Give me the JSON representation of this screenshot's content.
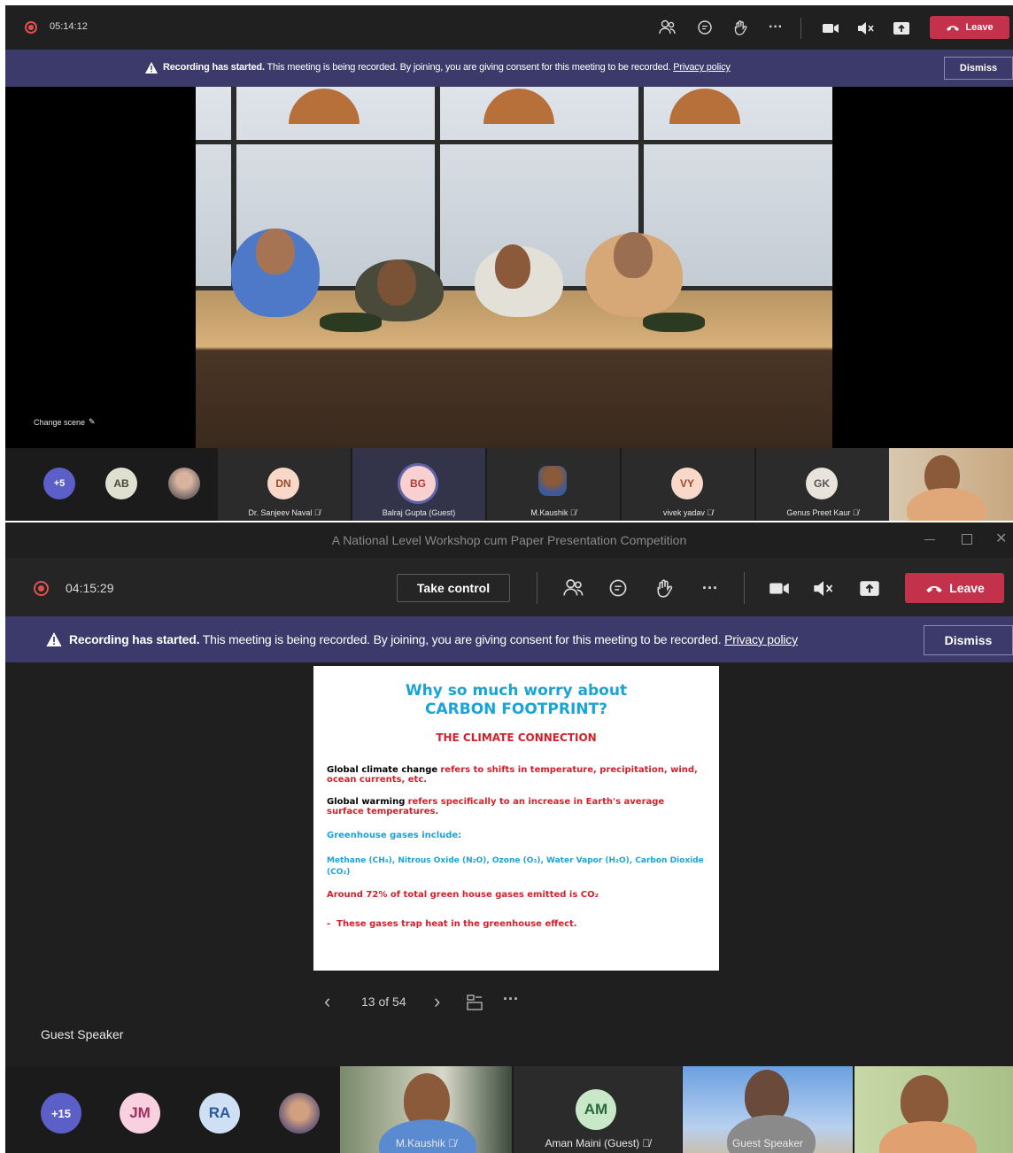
{
  "window1": {
    "timer": "05:14:12",
    "leave_label": "Leave",
    "banner": {
      "title": "Recording has started.",
      "text": "This meeting is being recorded. By joining, you are giving consent for this meeting to be recorded.",
      "link": "Privacy policy",
      "dismiss": "Dismiss"
    },
    "change_scene": "Change scene",
    "participants": [
      {
        "initials": "+5"
      },
      {
        "initials": "AB"
      },
      {
        "initials": ""
      },
      {
        "initials": "DN",
        "name": "Dr. Sanjeev Naval"
      },
      {
        "initials": "BG",
        "name": "Balraj Gupta (Guest)"
      },
      {
        "initials": "",
        "name": "M.Kaushik"
      },
      {
        "initials": "VY",
        "name": "vivek yadav"
      },
      {
        "initials": "GK",
        "name": "Genus Preet Kaur"
      }
    ]
  },
  "window2": {
    "title": "A National Level Workshop cum Paper Presentation Competition",
    "timer": "04:15:29",
    "take_control": "Take control",
    "leave_label": "Leave",
    "banner": {
      "title": "Recording has started.",
      "text": "This meeting is being recorded. By joining, you are giving consent for this meeting to be recorded.",
      "link": "Privacy policy",
      "dismiss": "Dismiss"
    },
    "slide": {
      "title_line1": "Why so much worry about",
      "title_line2": "CARBON FOOTPRINT?",
      "subtitle": "THE CLIMATE CONNECTION",
      "p1_black": "Global climate change",
      "p1_red": "refers to shifts in temperature, precipitation, wind, ocean currents, etc.",
      "p2_black": "Global warming",
      "p2_red": "refers specifically to an increase in Earth's average surface temperatures.",
      "p3": "Greenhouse gases include:",
      "p4": "Methane (CH₄), Nitrous Oxide (N₂O), Ozone (O₃), Water Vapor (H₂O), Carbon Dioxide (CO₂)",
      "p5": "Around 72% of total green house gases emitted is CO₂",
      "p6": "These gases trap heat in the greenhouse effect."
    },
    "slide_nav": {
      "page": "13 of 54"
    },
    "speaker_label": "Guest Speaker",
    "participants": [
      {
        "initials": "+15"
      },
      {
        "initials": "JM"
      },
      {
        "initials": "RA"
      },
      {
        "initials": ""
      },
      {
        "name": "M.Kaushik"
      },
      {
        "initials": "AM",
        "name": "Aman Maini (Guest)"
      },
      {
        "name": "Guest Speaker"
      },
      {
        "name": ""
      }
    ]
  },
  "colors": {
    "toolbar": "#202020",
    "banner": "#3b3a6b",
    "leave": "#c4314b",
    "slide_blue": "#1aa3d6",
    "slide_red": "#d4202a"
  }
}
